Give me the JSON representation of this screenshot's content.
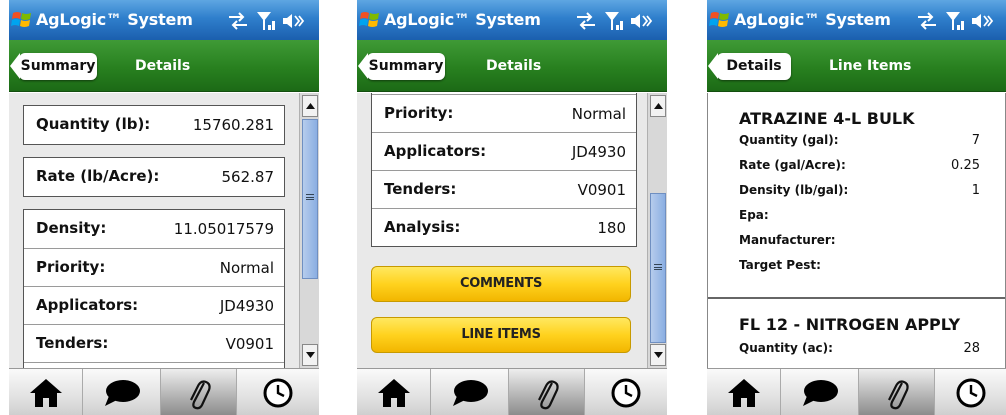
{
  "app": {
    "title": "AgLogic™ System"
  },
  "icons": {
    "windows": "windows-flag-icon",
    "connectivity": "connectivity-arrows-icon",
    "signal": "signal-antenna-icon",
    "volume": "speaker-icon"
  },
  "toolbar": {
    "items": [
      "home-icon",
      "comment-bubble-icon",
      "paperclip-icon",
      "clock-icon"
    ],
    "active": 2
  },
  "panel1": {
    "back_tab": "Summary",
    "tab": "Details",
    "rows_a": [
      {
        "label": "Quantity (lb):",
        "value": "15760.281"
      }
    ],
    "rows_b": [
      {
        "label": "Rate (lb/Acre):",
        "value": "562.87"
      }
    ],
    "rows_c": [
      {
        "label": "Density:",
        "value": "11.05017579"
      },
      {
        "label": "Priority:",
        "value": "Normal"
      },
      {
        "label": "Applicators:",
        "value": "JD4930"
      },
      {
        "label": "Tenders:",
        "value": "V0901"
      }
    ]
  },
  "panel2": {
    "back_tab": "Summary",
    "tab": "Details",
    "rows": [
      {
        "label": "Priority:",
        "value": "Normal"
      },
      {
        "label": "Applicators:",
        "value": "JD4930"
      },
      {
        "label": "Tenders:",
        "value": "V0901"
      },
      {
        "label": "Analysis:",
        "value": "180"
      }
    ],
    "buttons": {
      "comments": "COMMENTS",
      "line_items": "LINE ITEMS"
    }
  },
  "panel3": {
    "back_tab": "Details",
    "tab": "Line Items",
    "items": [
      {
        "title": "ATRAZINE 4-L BULK",
        "fields": [
          {
            "label": "Quantity (gal):",
            "value": "7"
          },
          {
            "label": "Rate (gal/Acre):",
            "value": "0.25"
          },
          {
            "label": "Density (lb/gal):",
            "value": "1"
          },
          {
            "label": "Epa:",
            "value": ""
          },
          {
            "label": "Manufacturer:",
            "value": ""
          },
          {
            "label": "Target Pest:",
            "value": ""
          }
        ]
      },
      {
        "title": "FL 12 - NITROGEN APPLY",
        "fields": [
          {
            "label": "Quantity (ac):",
            "value": "28"
          }
        ]
      }
    ]
  },
  "colors": {
    "titlebar": "#2f7fcc",
    "header": "#28801f",
    "button": "#ffd21e"
  }
}
